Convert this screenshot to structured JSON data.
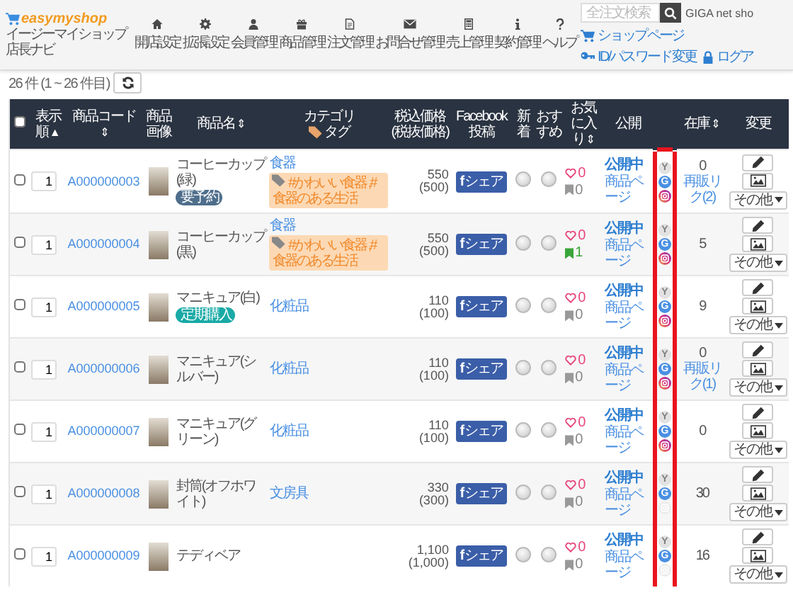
{
  "header": {
    "logo": "easymyshop",
    "subtitle": [
      "イージーマイショップ",
      "店長ナビ"
    ],
    "nav": [
      {
        "label": "開店設定"
      },
      {
        "label": "拡張設定"
      },
      {
        "label": "会員管理"
      },
      {
        "label": "商品管理"
      },
      {
        "label": "注文管理"
      },
      {
        "label": "お問合せ管理"
      },
      {
        "label": "売上管理"
      },
      {
        "label": "契約管理"
      },
      {
        "label": "ヘルプ"
      }
    ],
    "search": {
      "placeholder": "全注文検索"
    },
    "user": "GIGA net sho",
    "links": [
      {
        "label": "ショップページ"
      },
      {
        "label": "ID/パスワード変更"
      },
      {
        "label": "ログア"
      }
    ]
  },
  "count": "26 件 (1 ~ 26 件目)",
  "table": {
    "select_all_checked": false,
    "columns": [
      {
        "label": "表示順",
        "sort": "▲"
      },
      {
        "label": "商品コード",
        "sort": "⇕"
      },
      {
        "label": "商品画像"
      },
      {
        "label": "商品名",
        "sort": "⇕"
      },
      {
        "label": "カテゴリ",
        "sublabel": "タグ"
      },
      {
        "label": "税込価格",
        "sublabel": "(税抜価格)"
      },
      {
        "label": "Facebook投稿"
      },
      {
        "label": "新着"
      },
      {
        "label": "おすすめ"
      },
      {
        "label": "お気に入り",
        "sort": "⇕"
      },
      {
        "label": "公開"
      },
      {
        "highlighted": true
      },
      {
        "label": "在庫",
        "sort": "⇕"
      },
      {
        "label": "変更"
      }
    ],
    "rows": [
      {
        "checked": false,
        "order": "1",
        "code": "A000000003",
        "name": "コーヒーカップ(緑)",
        "badge": {
          "text": "要予約",
          "color": "#4f6e8c"
        },
        "category": "食器",
        "tags": "#かわいい食器 ,#食器のある生活",
        "price": "550",
        "price_ex": "(500)",
        "facebook": "**f**シェア",
        "new": false,
        "recommended": false,
        "likes": "0",
        "bookmarks": "0",
        "bookmarked": false,
        "status": "公開中",
        "page_link": "商品ページ",
        "social": [
          {
            "kind": "letter",
            "text": "Y",
            "on": false
          },
          {
            "kind": "letter",
            "text": "G",
            "on": true
          },
          {
            "kind": "camera",
            "on": true
          }
        ],
        "stock": "0",
        "restock": "再販リク(2)",
        "more": "その他"
      },
      {
        "checked": false,
        "order": "1",
        "code": "A000000004",
        "name": "コーヒーカップ(黒)",
        "category": "食器",
        "tags": "#かわいい食器 ,#食器のある生活",
        "price": "550",
        "price_ex": "(500)",
        "facebook": "**f**シェア",
        "new": false,
        "recommended": false,
        "likes": "0",
        "bookmarks": "1",
        "bookmarked": true,
        "status": "公開中",
        "page_link": "商品ページ",
        "social": [
          {
            "kind": "letter",
            "text": "Y",
            "on": false
          },
          {
            "kind": "letter",
            "text": "G",
            "on": true
          },
          {
            "kind": "camera",
            "on": true
          }
        ],
        "stock": "5",
        "more": "その他"
      },
      {
        "checked": false,
        "order": "1",
        "code": "A000000005",
        "name": "マニキュア(白)",
        "badge": {
          "text": "定期購入",
          "color": "#19aaa6"
        },
        "category": "化粧品",
        "price": "110",
        "price_ex": "(100)",
        "facebook": "**f**シェア",
        "new": false,
        "recommended": false,
        "likes": "0",
        "bookmarks": "0",
        "bookmarked": false,
        "status": "公開中",
        "page_link": "商品ページ",
        "social": [
          {
            "kind": "letter",
            "text": "Y",
            "on": false
          },
          {
            "kind": "letter",
            "text": "G",
            "on": true
          },
          {
            "kind": "camera",
            "on": true
          }
        ],
        "stock": "9",
        "more": "その他"
      },
      {
        "checked": false,
        "order": "1",
        "code": "A000000006",
        "name": "マニキュア(シルバー)",
        "category": "化粧品",
        "price": "110",
        "price_ex": "(100)",
        "facebook": "**f**シェア",
        "new": false,
        "recommended": false,
        "likes": "0",
        "bookmarks": "0",
        "bookmarked": false,
        "status": "公開中",
        "page_link": "商品ページ",
        "social": [
          {
            "kind": "letter",
            "text": "Y",
            "on": false
          },
          {
            "kind": "letter",
            "text": "G",
            "on": true
          },
          {
            "kind": "camera",
            "on": true
          }
        ],
        "stock": "0",
        "restock": "再販リク(1)",
        "more": "その他"
      },
      {
        "checked": false,
        "order": "1",
        "code": "A000000007",
        "name": "マニキュア(グリーン)",
        "category": "化粧品",
        "price": "110",
        "price_ex": "(100)",
        "facebook": "**f**シェア",
        "new": false,
        "recommended": false,
        "likes": "0",
        "bookmarks": "0",
        "bookmarked": false,
        "status": "公開中",
        "page_link": "商品ページ",
        "social": [
          {
            "kind": "letter",
            "text": "Y",
            "on": false
          },
          {
            "kind": "letter",
            "text": "G",
            "on": true
          },
          {
            "kind": "camera",
            "on": true
          }
        ],
        "stock": "0",
        "more": "その他"
      },
      {
        "checked": false,
        "order": "1",
        "code": "A000000008",
        "name": "封筒(オフホワイト)",
        "category": "文房具",
        "price": "330",
        "price_ex": "(300)",
        "facebook": "**f**シェア",
        "new": false,
        "recommended": false,
        "likes": "0",
        "bookmarks": "0",
        "bookmarked": false,
        "status": "公開中",
        "page_link": "商品ページ",
        "social": [
          {
            "kind": "letter",
            "text": "Y",
            "on": false
          },
          {
            "kind": "letter",
            "text": "G",
            "on": true
          },
          {
            "kind": "camera",
            "on": false
          }
        ],
        "stock": "30",
        "more": "その他"
      },
      {
        "checked": false,
        "order": "1",
        "code": "A000000009",
        "name": "テディベア",
        "price": "1,100",
        "price_ex": "(1,000)",
        "facebook": "**f**シェア",
        "new": false,
        "recommended": false,
        "likes": "0",
        "bookmarks": "0",
        "bookmarked": false,
        "status": "公開中",
        "page_link": "商品ページ",
        "social": [
          {
            "kind": "letter",
            "text": "Y",
            "on": false
          },
          {
            "kind": "letter",
            "text": "G",
            "on": true
          },
          {
            "kind": "camera",
            "on": false
          }
        ],
        "stock": "16",
        "more": "その他"
      }
    ]
  }
}
